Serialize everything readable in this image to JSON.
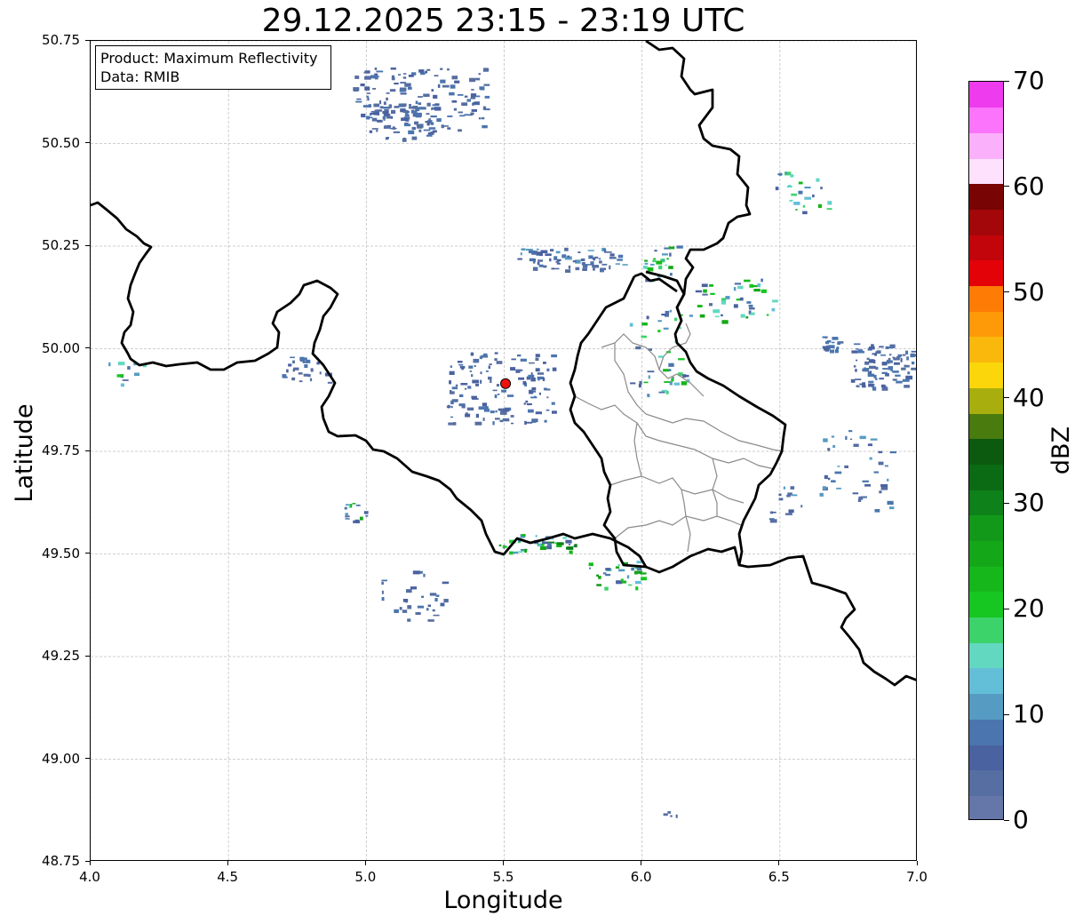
{
  "title": "29.12.2025 23:15 - 23:19 UTC",
  "info_box": {
    "product": "Product: Maximum Reflectivity",
    "data": "Data: RMIB"
  },
  "axes": {
    "xlabel": "Longitude",
    "ylabel": "Latitude",
    "xlim": [
      4.0,
      7.0
    ],
    "ylim": [
      48.75,
      50.75
    ],
    "xticks": [
      "4.0",
      "4.5",
      "5.0",
      "5.5",
      "6.0",
      "6.5",
      "7.0"
    ],
    "yticks": [
      "50.75",
      "50.50",
      "50.25",
      "50.00",
      "49.75",
      "49.50",
      "49.25",
      "49.00",
      "48.75"
    ],
    "grid": true
  },
  "colorbar": {
    "label": "dBZ",
    "ticks": [
      "0",
      "10",
      "20",
      "30",
      "40",
      "50",
      "60",
      "70"
    ],
    "range": [
      0,
      70
    ],
    "colors": [
      "#6577a8",
      "#566ea1",
      "#4a62a0",
      "#4b75ae",
      "#569bc2",
      "#63bfd7",
      "#62d8c1",
      "#3dd36b",
      "#16c721",
      "#16b71b",
      "#14a819",
      "#12991a",
      "#0e811a",
      "#0b6a14",
      "#0b5a0f",
      "#4a7b0e",
      "#a8ae0e",
      "#fbd60b",
      "#fbb80c",
      "#fe9a08",
      "#fe7b05",
      "#e30208",
      "#c2050a",
      "#a30709",
      "#780404",
      "#fde1fd",
      "#fbb0fb",
      "#fc74fb",
      "#ee3bee"
    ]
  },
  "radar_site": {
    "lon": 5.505,
    "lat": 49.915,
    "color": "#ee1111"
  },
  "map_colors": {
    "border": "#000000",
    "admin": "#8a8a8a",
    "grid": "#c0c0c0"
  }
}
